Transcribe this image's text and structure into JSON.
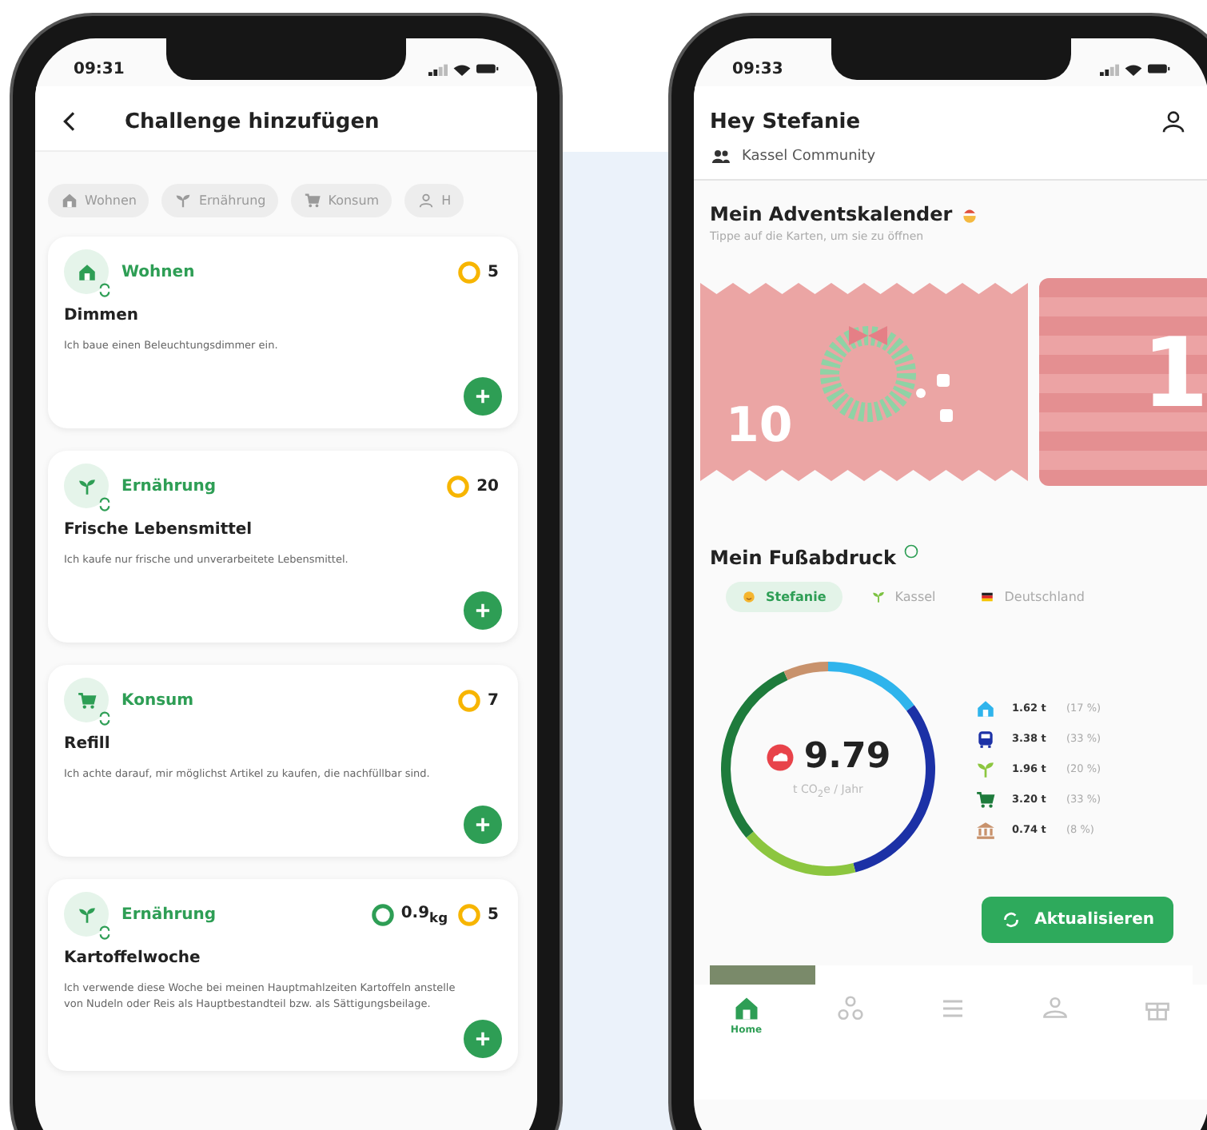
{
  "challenge_screen": {
    "status_bar": {
      "time": "09:31"
    },
    "title": "Challenge hinzufügen",
    "filter_chips": [
      {
        "kind": "home",
        "label": "Wohnen"
      },
      {
        "kind": "sprout",
        "label": "Ernährung"
      },
      {
        "kind": "cart",
        "label": "Konsum"
      },
      {
        "kind": "person",
        "label": "H"
      }
    ],
    "cards": [
      {
        "kind": "home",
        "category": "Wohnen",
        "points": "5",
        "title": "Dimmen",
        "description": "Ich baue einen Beleuchtungsdimmer ein."
      },
      {
        "kind": "sprout",
        "category": "Ernährung",
        "points": "20",
        "title": "Frische Lebensmittel",
        "description": "Ich kaufe nur frische und unverarbeitete Lebensmittel."
      },
      {
        "kind": "cart",
        "category": "Konsum",
        "points": "7",
        "title": "Refill",
        "description": "Ich achte darauf, mir möglichst Artikel zu kaufen, die nachfüllbar sind."
      },
      {
        "kind": "sprout",
        "category": "Ernährung",
        "co2": "0.9$_{kg}$",
        "points": "5",
        "title": "Kartoffelwoche",
        "description": "Ich verwende diese Woche bei meinen Hauptmahlzeiten Kartoffeln anstelle von Nudeln oder Reis als Hauptbestandteil bzw. als Sättigungsbeilage."
      }
    ]
  },
  "home_screen": {
    "status_bar": {
      "time": "09:33"
    },
    "greeting": "Hey Stefanie",
    "community": "Kassel Community",
    "advent": {
      "title": "Mein Adventskalender",
      "hint": "Tippe auf die Karten, um sie zu öffnen",
      "cards": [
        {
          "kind": "wreath",
          "day": "10"
        },
        {
          "kind": "stripes",
          "day": "1"
        }
      ]
    },
    "footprint": {
      "title": "Mein Fußabdruck",
      "tabs": [
        {
          "kind": "face",
          "label": "Stefanie",
          "selected": true
        },
        {
          "kind": "sprout",
          "label": "Kassel",
          "selected": false
        },
        {
          "kind": "flag",
          "label": "Deutschland",
          "selected": false
        }
      ],
      "total": "9.79",
      "unit": "t CO$_{2}$e / Jahr",
      "legend": [
        {
          "kind": "home",
          "color": "#2fb4ec",
          "amount": "1.62 t",
          "share": "(17 %)"
        },
        {
          "kind": "bus",
          "color": "#1c31a6",
          "amount": "3.38 t",
          "share": "(33 %)"
        },
        {
          "kind": "sprout",
          "color": "#8cc63f",
          "amount": "1.96 t",
          "share": "(20 %)"
        },
        {
          "kind": "cart",
          "color": "#1e7b3c",
          "amount": "3.20 t",
          "share": "(33 %)"
        },
        {
          "kind": "bank",
          "color": "#c8926c",
          "amount": "0.74 t",
          "share": "(8 %)"
        }
      ],
      "button": "Aktualisieren"
    },
    "nav": [
      {
        "kind": "home",
        "label": "Home",
        "selected": true
      },
      {
        "kind": "molecule",
        "selected": false
      },
      {
        "kind": "list",
        "selected": false
      },
      {
        "kind": "people",
        "selected": false
      },
      {
        "kind": "gift",
        "selected": false
      }
    ]
  }
}
